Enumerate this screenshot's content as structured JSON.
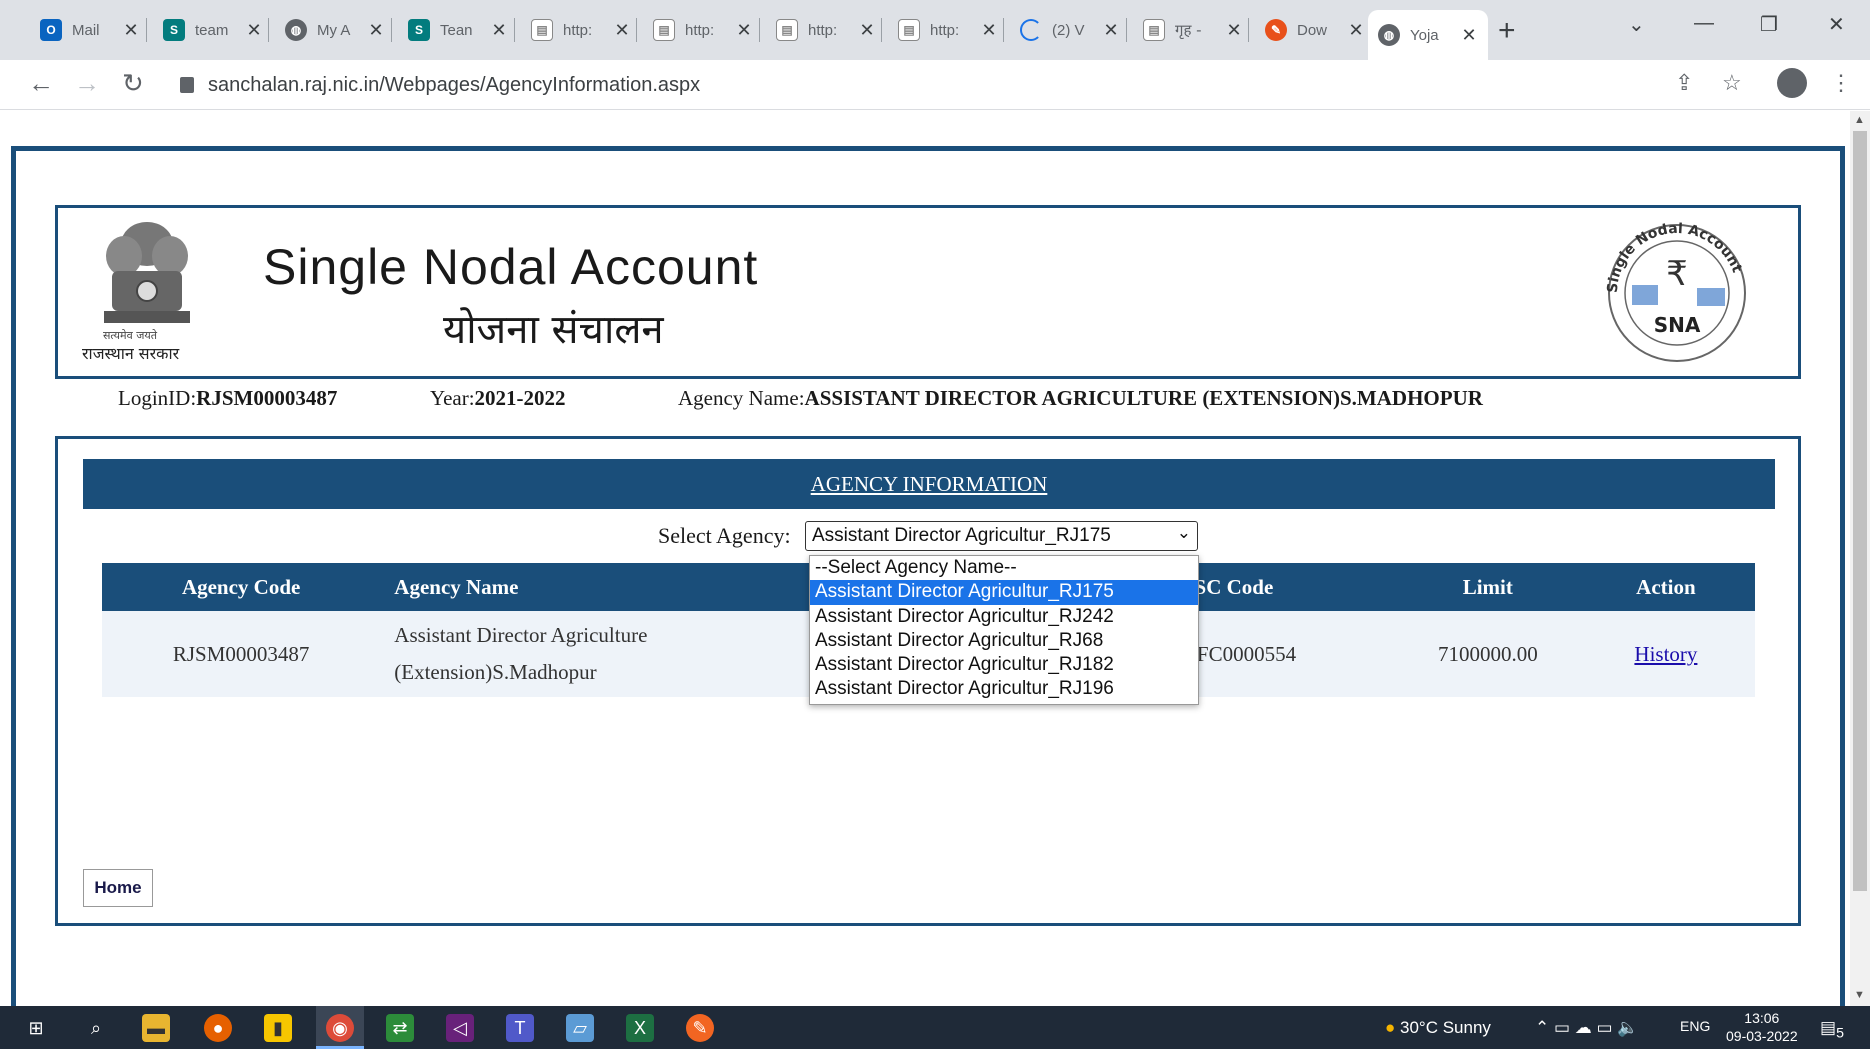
{
  "browser": {
    "tabs": [
      {
        "title": "Mail",
        "icon": "outlook-icon",
        "color": "#0a64c0"
      },
      {
        "title": "team",
        "icon": "sharepoint-icon",
        "color": "#037c7e"
      },
      {
        "title": "My A",
        "icon": "globe-icon",
        "color": "#5f6368"
      },
      {
        "title": "Tean",
        "icon": "sharepoint-icon",
        "color": "#037c7e"
      },
      {
        "title": "http:",
        "icon": "document-icon",
        "color": "#5f6368"
      },
      {
        "title": "http:",
        "icon": "document-icon",
        "color": "#5f6368"
      },
      {
        "title": "http:",
        "icon": "document-icon",
        "color": "#5f6368"
      },
      {
        "title": "http:",
        "icon": "document-icon",
        "color": "#5f6368"
      },
      {
        "title": "(2) V",
        "icon": "loading-icon",
        "color": "#5f6368"
      },
      {
        "title": "गृह -",
        "icon": "document-icon",
        "color": "#5f6368"
      },
      {
        "title": "Dow",
        "icon": "download-site-icon",
        "color": "#e8501a"
      },
      {
        "title": "Yoja",
        "icon": "globe-icon",
        "color": "#5f6368"
      }
    ],
    "url": "sanchalan.raj.nic.in/Webpages/AgencyInformation.aspx"
  },
  "header": {
    "title": "Single Nodal Account",
    "subtitle": "योजना संचालन",
    "emblem_motto": "सत्यमेव जयते",
    "emblem_caption": "राजस्थान सरकार",
    "logo_ring_text": "Single Nodal Account",
    "logo_text": "SNA",
    "logo_symbol": "₹"
  },
  "info": {
    "login_label": "LoginID:",
    "login_value": "RJSM00003487",
    "year_label": "Year:",
    "year_value": "2021-2022",
    "agency_label": "Agency Name:",
    "agency_value": "ASSISTANT DIRECTOR AGRICULTURE (EXTENSION)S.MADHOPUR"
  },
  "section": {
    "title": "AGENCY INFORMATION",
    "select_label": "Select Agency:",
    "select_value": "Assistant Director Agricultur_RJ175",
    "select_options": [
      "--Select Agency Name--",
      "Assistant Director Agricultur_RJ175",
      "Assistant Director Agricultur_RJ242",
      "Assistant Director Agricultur_RJ68",
      "Assistant Director Agricultur_RJ182",
      "Assistant Director Agricultur_RJ196"
    ]
  },
  "table": {
    "headers": [
      "Agency Code",
      "Agency Name",
      "FSC Code",
      "Limit",
      "Action"
    ],
    "row": {
      "code": "RJSM00003487",
      "name_line1": "Assistant Director Agriculture",
      "name_line2": "(Extension)S.Madhopur",
      "ifsc": "DFC0000554",
      "limit": "7100000.00",
      "action": "History"
    }
  },
  "home_label": "Home",
  "taskbar": {
    "weather": "30°C  Sunny",
    "lang": "ENG",
    "time": "13:06",
    "date": "09-03-2022",
    "notif_count": "5"
  },
  "colors": {
    "brand": "#1a4e7a",
    "selection": "#1a73e8"
  }
}
